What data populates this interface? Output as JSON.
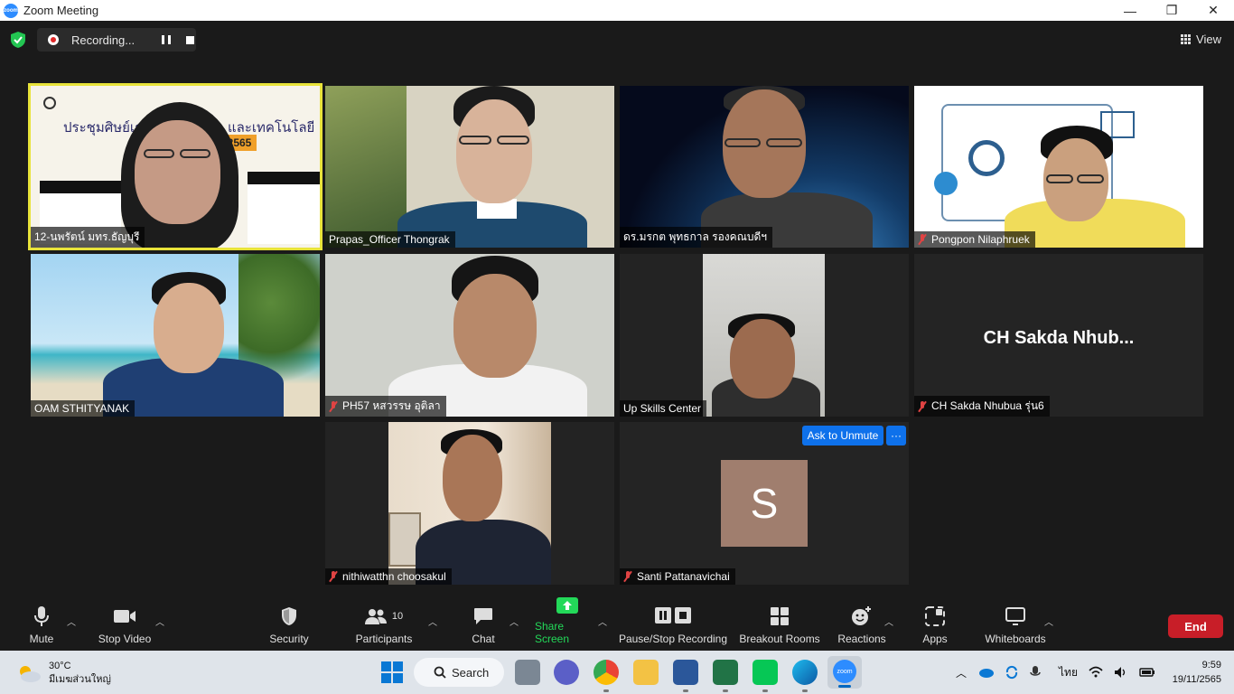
{
  "window": {
    "title": "Zoom Meeting",
    "app_icon_text": "zoom"
  },
  "window_controls": {
    "minimize": "—",
    "restore": "❐",
    "close": "✕"
  },
  "recording": {
    "label": "Recording..."
  },
  "view": {
    "label": "View"
  },
  "tiles": [
    {
      "name": "12-นพรัตน์ มทร.ธัญบุรี",
      "muted": false,
      "active_speaker": true
    },
    {
      "name": "Prapas_Officer Thongrak",
      "muted": false
    },
    {
      "name": "ดร.มรกต พุทธกาล รองคณบดีฯ",
      "muted": false
    },
    {
      "name": "Pongpon Nilaphruek",
      "muted": true
    },
    {
      "name": "OAM STHITYANAK",
      "muted": false
    },
    {
      "name": "PH57 หสวรรษ อุติลา",
      "muted": true
    },
    {
      "name": "Up Skills Center",
      "muted": false
    },
    {
      "name": "CH Sakda Nhubua รุ่น6",
      "muted": true,
      "display_name": "CH Sakda Nhub..."
    },
    {
      "name": "nithiwatthn choosakul",
      "muted": true
    },
    {
      "name": "Santi Pattanavichai",
      "muted": true,
      "avatar_letter": "S",
      "ask_to_unmute": "Ask to Unmute",
      "more": "···"
    }
  ],
  "tile1_slide": {
    "line1": "ประชุมศิษย์เก่า",
    "line2": "และเทคโนโลยี",
    "line3": "2565"
  },
  "toolbar": {
    "mute": "Mute",
    "stop_video": "Stop Video",
    "security": "Security",
    "participants": "Participants",
    "participants_count": "10",
    "chat": "Chat",
    "share_screen": "Share Screen",
    "pause_stop_recording": "Pause/Stop Recording",
    "breakout_rooms": "Breakout Rooms",
    "reactions": "Reactions",
    "apps": "Apps",
    "whiteboards": "Whiteboards",
    "end": "End"
  },
  "taskbar": {
    "weather_temp": "30°C",
    "weather_desc": "มีเมฆส่วนใหญ่",
    "search": "Search",
    "language": "ไทย",
    "time": "9:59",
    "date": "19/11/2565"
  },
  "colors": {
    "accent_blue": "#0e71eb",
    "share_green": "#23d959",
    "end_red": "#c81e28",
    "active_speaker_border": "#e8e33a"
  }
}
